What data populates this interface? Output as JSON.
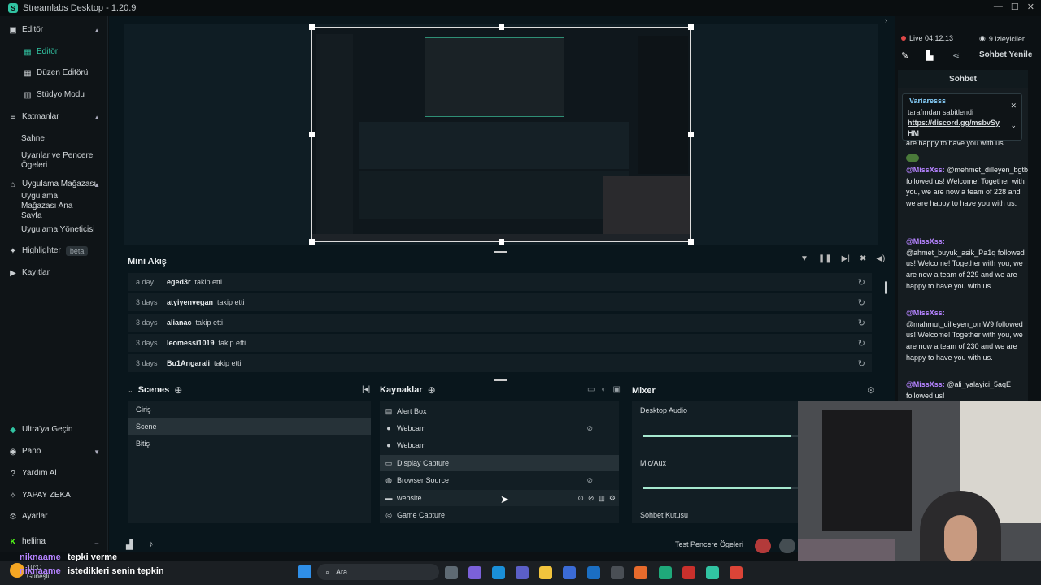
{
  "app": {
    "title": "Streamlabs Desktop - 1.20.9",
    "logo": "streamlabs-logo-icon"
  },
  "sidebar": {
    "groups": [
      {
        "label": "Editör",
        "items": [
          {
            "label": "Editör",
            "icon": "editor-icon",
            "active": true
          },
          {
            "label": "Düzen Editörü",
            "icon": "layout-icon"
          },
          {
            "label": "Stüdyo Modu",
            "icon": "studio-icon"
          }
        ]
      },
      {
        "label": "Katmanlar",
        "items": [
          {
            "label": "Sahne"
          },
          {
            "label": "Uyarılar ve Pencere Ögeleri"
          }
        ]
      },
      {
        "label": "Uygulama Mağazası",
        "items": [
          {
            "label": "Uygulama Mağazası Ana Sayfa"
          },
          {
            "label": "Uygulama Yöneticisi"
          }
        ]
      }
    ],
    "highlighter": {
      "label": "Highlighter",
      "badge": "beta"
    },
    "recordings": "Kayıtlar",
    "bottom": [
      {
        "label": "Ultra'ya Geçin",
        "icon": "ultra-icon"
      },
      {
        "label": "Pano",
        "icon": "dashboard-icon"
      },
      {
        "label": "Yardım Al",
        "icon": "help-icon"
      },
      {
        "label": "YAPAY ZEKA",
        "icon": "ai-icon"
      },
      {
        "label": "Ayarlar",
        "icon": "settings-icon"
      }
    ],
    "user": "heliina"
  },
  "minifeed": {
    "title": "Mini Akış",
    "rows": [
      {
        "ago": "a day",
        "user": "eged3r",
        "action": "takip etti"
      },
      {
        "ago": "3 days",
        "user": "atyiyenvegan",
        "action": "takip etti"
      },
      {
        "ago": "3 days",
        "user": "alianac",
        "action": "takip etti"
      },
      {
        "ago": "3 days",
        "user": "leomessi1019",
        "action": "takip etti"
      },
      {
        "ago": "3 days",
        "user": "Bu1Angarali",
        "action": "takip etti"
      }
    ]
  },
  "scenes": {
    "title": "Scenes",
    "items": [
      "Giriş",
      "Scene",
      "Bitiş"
    ],
    "selected": 1
  },
  "sources": {
    "title": "Kaynaklar",
    "items": [
      {
        "label": "Alert Box",
        "icon": "alertbox-icon"
      },
      {
        "label": "Webcam",
        "icon": "webcam-icon",
        "hidden": true
      },
      {
        "label": "Webcam",
        "icon": "webcam-icon"
      },
      {
        "label": "Display Capture",
        "icon": "monitor-icon",
        "selected": true
      },
      {
        "label": "Browser Source",
        "icon": "globe-icon",
        "hidden": true
      },
      {
        "label": "website",
        "icon": "browser-icon"
      },
      {
        "label": "Game Capture",
        "icon": "gamepad-icon"
      }
    ]
  },
  "mixer": {
    "title": "Mixer",
    "channels": [
      {
        "label": "Desktop Audio",
        "level": 0.95
      },
      {
        "label": "Mic/Aux",
        "level": 0.95
      },
      {
        "label": "Sohbet Kutusu"
      }
    ]
  },
  "footer": {
    "test_widgets": "Test Pencere Ögeleri"
  },
  "live": {
    "status": "Live 04:12:13",
    "viewers": "9 izleyiciler",
    "refresh_chat": "Sohbet Yenile",
    "chat_tab": "Sohbet"
  },
  "pinned": {
    "user": "Variaresss",
    "text": "tarafından sabitlendi",
    "link": "https://discord.gg/msbvSyHM",
    "trailing": "are happy to have you with us."
  },
  "chat": [
    {
      "user": "@MissXss:",
      "text": "@mehmet_dilleyen_bgtb followed us! Welcome! Together with you, we are now a team of 228 and we are happy to have you with us."
    },
    {
      "user": "@MissXss:",
      "text": "@ahmet_buyuk_asik_Pa1q followed us! Welcome! Together with you, we are now a team of 229 and we are happy to have you with us."
    },
    {
      "user": "@MissXss:",
      "text": "@mahmut_dilleyen_omW9 followed us! Welcome! Together with you, we are now a team of 230 and we are happy to have you with us."
    },
    {
      "user": "@MissXss:",
      "text": "@ali_yalayici_5aqE followed us!"
    }
  ],
  "overlay": {
    "line1_user": "niknaame",
    "line1_text": "tepki verme",
    "line2_user": "niknaame",
    "line2_text": "istedikleri senin tepkin"
  },
  "taskbar": {
    "search": "Ara",
    "weather": "10°C",
    "weather_label": "Güneşli"
  }
}
